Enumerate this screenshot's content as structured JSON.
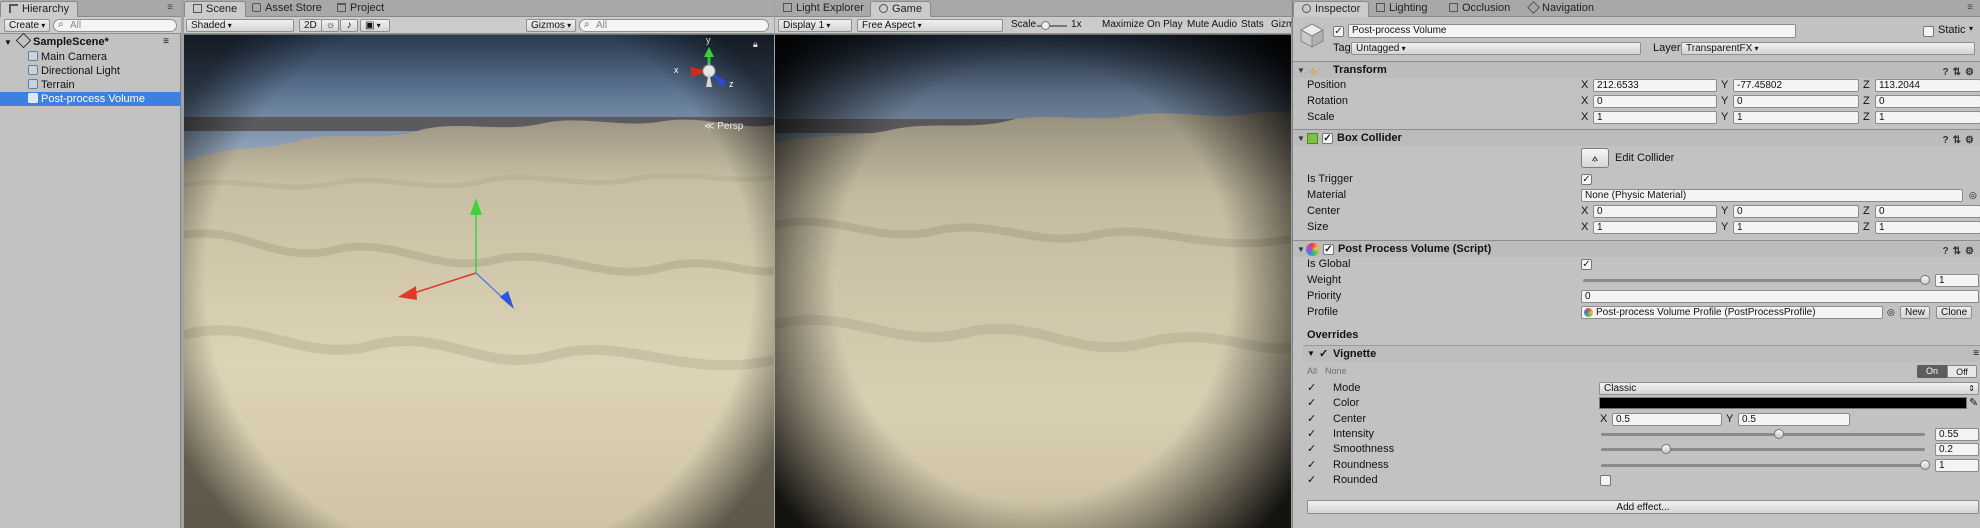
{
  "hierarchy": {
    "tab": "Hierarchy",
    "create_label": "Create",
    "search_placeholder": "All",
    "scene": "SampleScene*",
    "items": [
      "Main Camera",
      "Directional Light",
      "Terrain",
      "Post-process Volume"
    ]
  },
  "scene_panel": {
    "tabs": [
      "Scene",
      "Asset Store",
      "Project"
    ],
    "shading_mode": "Shaded",
    "mode_2d": "2D",
    "gizmos_label": "Gizmos",
    "search_placeholder": "All",
    "gizmo_axes": {
      "x": "x",
      "y": "y",
      "z": "z"
    },
    "persp_label": "Persp"
  },
  "game_panel": {
    "tabs": [
      "Light Explorer",
      "Game"
    ],
    "display": "Display 1",
    "aspect": "Free Aspect",
    "scale_label": "Scale",
    "scale_value": "1x",
    "maximize_on_play": "Maximize On Play",
    "mute_audio": "Mute Audio",
    "stats": "Stats",
    "gizmos_label": "Gizm"
  },
  "inspector": {
    "tabs": [
      "Inspector",
      "Lighting",
      "Occlusion",
      "Navigation"
    ],
    "object_name": "Post-process Volume",
    "static_label": "Static",
    "tag_label": "Tag",
    "tag_value": "Untagged",
    "layer_label": "Layer",
    "layer_value": "TransparentFX",
    "transform": {
      "title": "Transform",
      "position_label": "Position",
      "rotation_label": "Rotation",
      "scale_label": "Scale",
      "position": {
        "x": "212.6533",
        "y": "-77.45802",
        "z": "113.2044"
      },
      "rotation": {
        "x": "0",
        "y": "0",
        "z": "0"
      },
      "scale": {
        "x": "1",
        "y": "1",
        "z": "1"
      }
    },
    "box_collider": {
      "title": "Box Collider",
      "edit_collider": "Edit Collider",
      "is_trigger_label": "Is Trigger",
      "material_label": "Material",
      "material_value": "None (Physic Material)",
      "center_label": "Center",
      "size_label": "Size",
      "center": {
        "x": "0",
        "y": "0",
        "z": "0"
      },
      "size": {
        "x": "1",
        "y": "1",
        "z": "1"
      }
    },
    "ppv": {
      "title": "Post Process Volume (Script)",
      "is_global_label": "Is Global",
      "weight_label": "Weight",
      "weight_value": "1",
      "weight_fraction": 1.0,
      "priority_label": "Priority",
      "priority_value": "0",
      "profile_label": "Profile",
      "profile_value": "Post-process Volume Profile (PostProcessProfile)",
      "new_button": "New",
      "clone_button": "Clone",
      "overrides_label": "Overrides"
    },
    "vignette": {
      "title": "Vignette",
      "all_label": "All",
      "none_label": "None",
      "on_label": "On",
      "off_label": "Off",
      "mode_label": "Mode",
      "mode_value": "Classic",
      "color_label": "Color",
      "color_value": "#000000",
      "center_label": "Center",
      "center_x": "0.5",
      "center_y": "0.5",
      "intensity_label": "Intensity",
      "intensity_value": "0.55",
      "intensity_fraction": 0.55,
      "smoothness_label": "Smoothness",
      "smoothness_value": "0.2",
      "smoothness_fraction": 0.2,
      "roundness_label": "Roundness",
      "roundness_value": "1",
      "roundness_fraction": 1.0,
      "rounded_label": "Rounded"
    },
    "add_effect": "Add effect..."
  },
  "colors": {
    "selection": "#3d80df",
    "panel": "#c2c2c2",
    "sand": "#d9cfb2"
  }
}
